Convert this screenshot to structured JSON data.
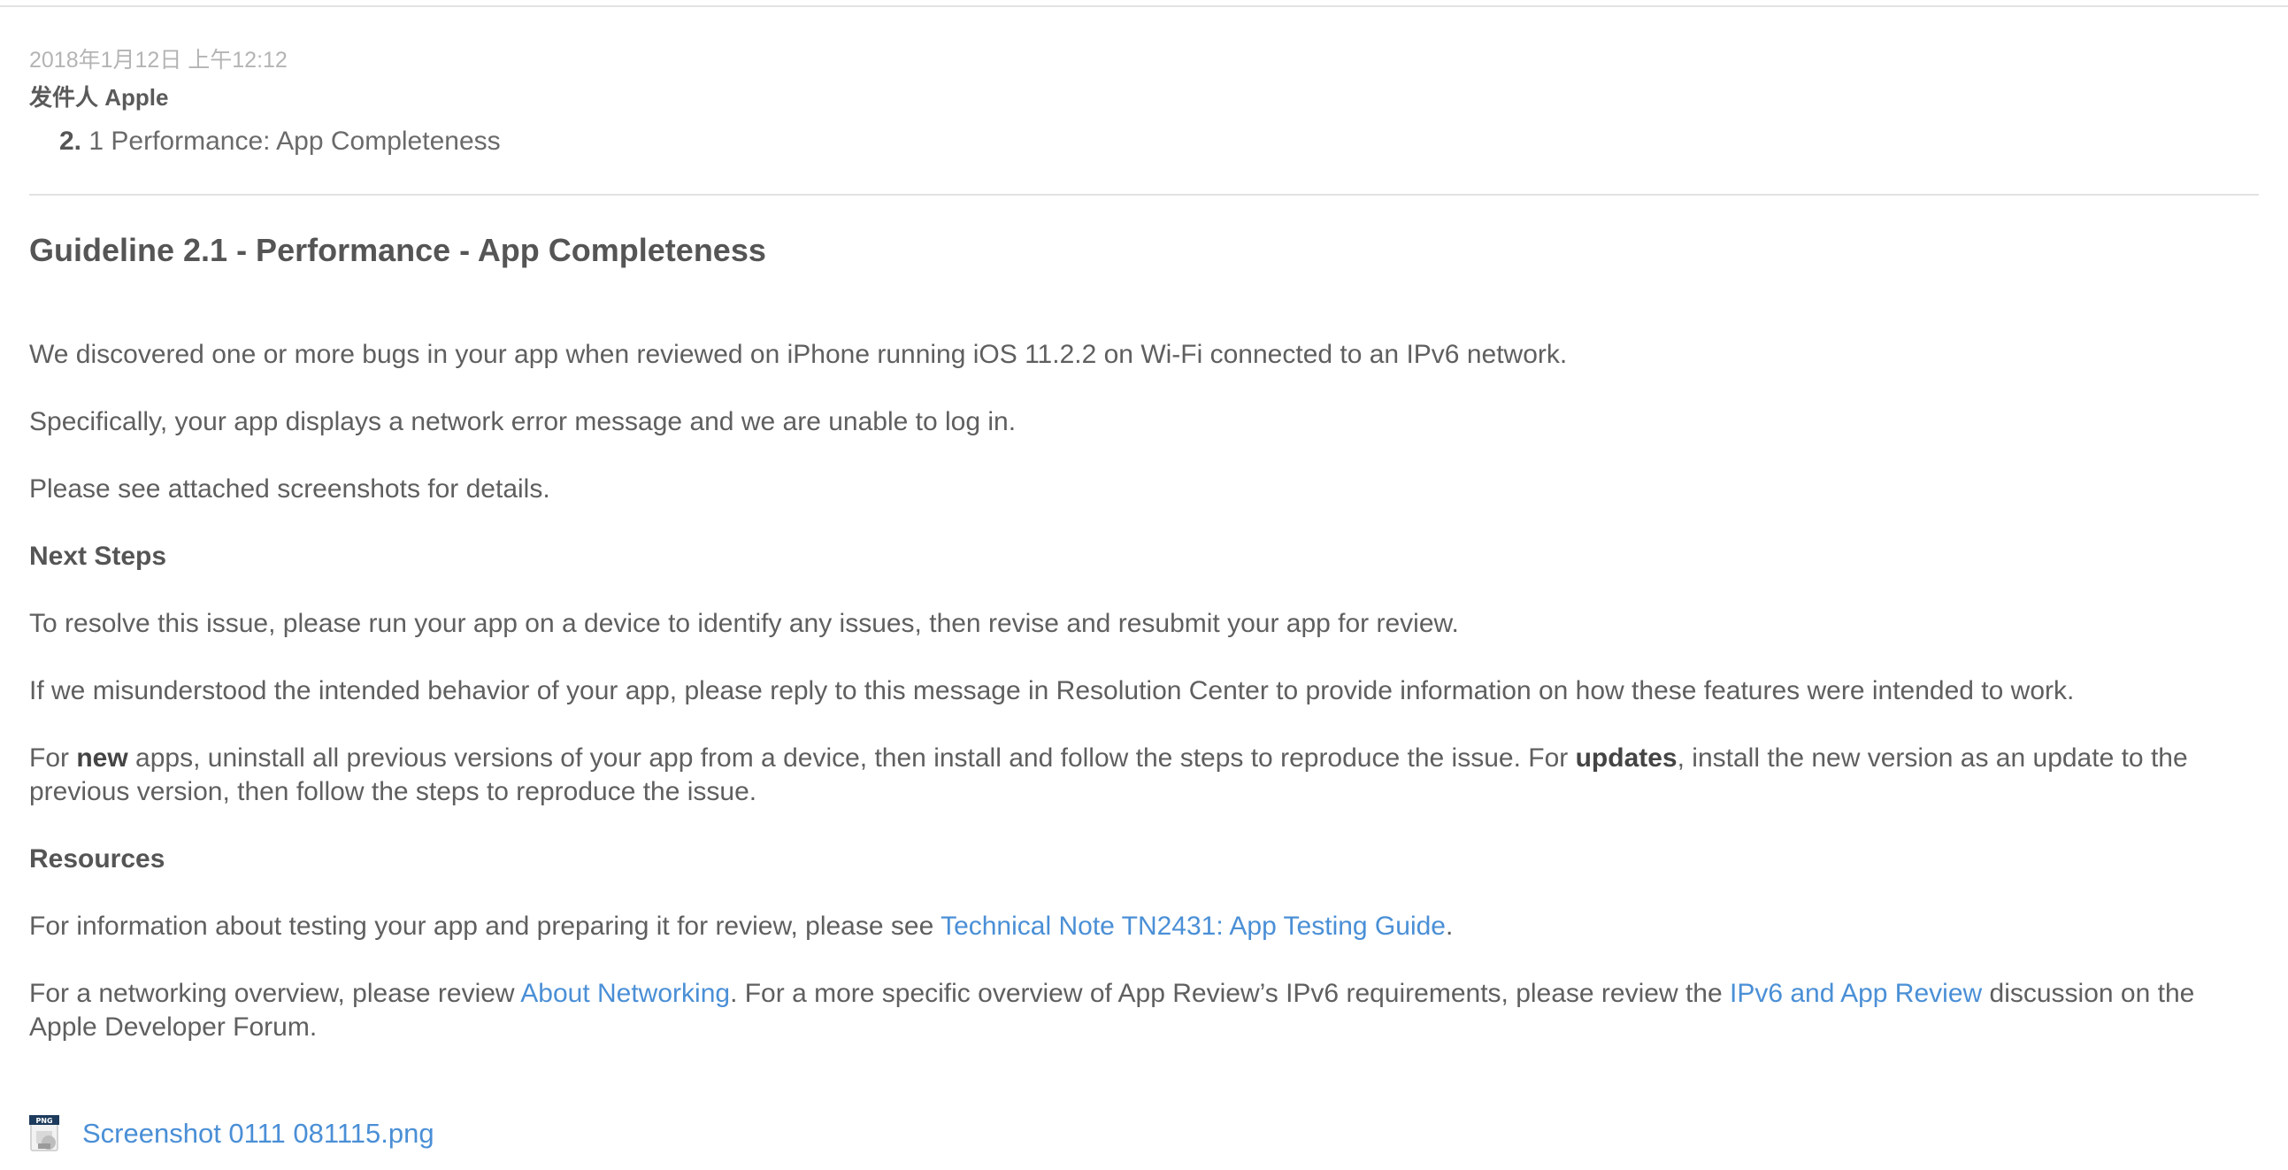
{
  "meta": {
    "date": "2018年1月12日 上午12:12",
    "sender": "发件人 Apple"
  },
  "subject": {
    "number": "2.",
    "text": "1 Performance: App Completeness"
  },
  "guideline_title": "Guideline 2.1 - Performance - App Completeness",
  "body": {
    "p1": "We discovered one or more bugs in your app when reviewed on iPhone running iOS 11.2.2 on Wi-Fi connected to an IPv6 network.",
    "p2": "Specifically, your app displays a network error message and we are unable to log in.",
    "p3": "Please see attached screenshots for details.",
    "next_steps_heading": "Next Steps",
    "p4": "To resolve this issue, please run your app on a device to identify any issues, then revise and resubmit your app for review.",
    "p5": "If we misunderstood the intended behavior of your app, please reply to this message in Resolution Center to provide information on how these features were intended to work.",
    "p6_a": "For ",
    "p6_new": "new",
    "p6_b": " apps, uninstall all previous versions of your app from a device, then install and follow the steps to reproduce the issue. For ",
    "p6_updates": "updates",
    "p6_c": ", install the new version as an update to the previous version, then follow the steps to reproduce the issue.",
    "resources_heading": "Resources",
    "p7_a": "For information about testing your app and preparing it for review, please see ",
    "p7_link": "Technical Note TN2431: App Testing Guide",
    "p7_b": ".",
    "p8_a": "For a networking overview, please review ",
    "p8_link1": "About Networking",
    "p8_b": ". For a more specific overview of App Review’s IPv6 requirements, please review the ",
    "p8_link2": "IPv6 and App Review",
    "p8_c": " discussion on the Apple Developer Forum."
  },
  "attachment": {
    "icon": "png-file-icon",
    "icon_badge": "PNG",
    "filename": "Screenshot 0111 081115.png"
  },
  "colors": {
    "link": "#4a8fd6",
    "text": "#5f5f5f",
    "muted": "#b4b4b4"
  }
}
